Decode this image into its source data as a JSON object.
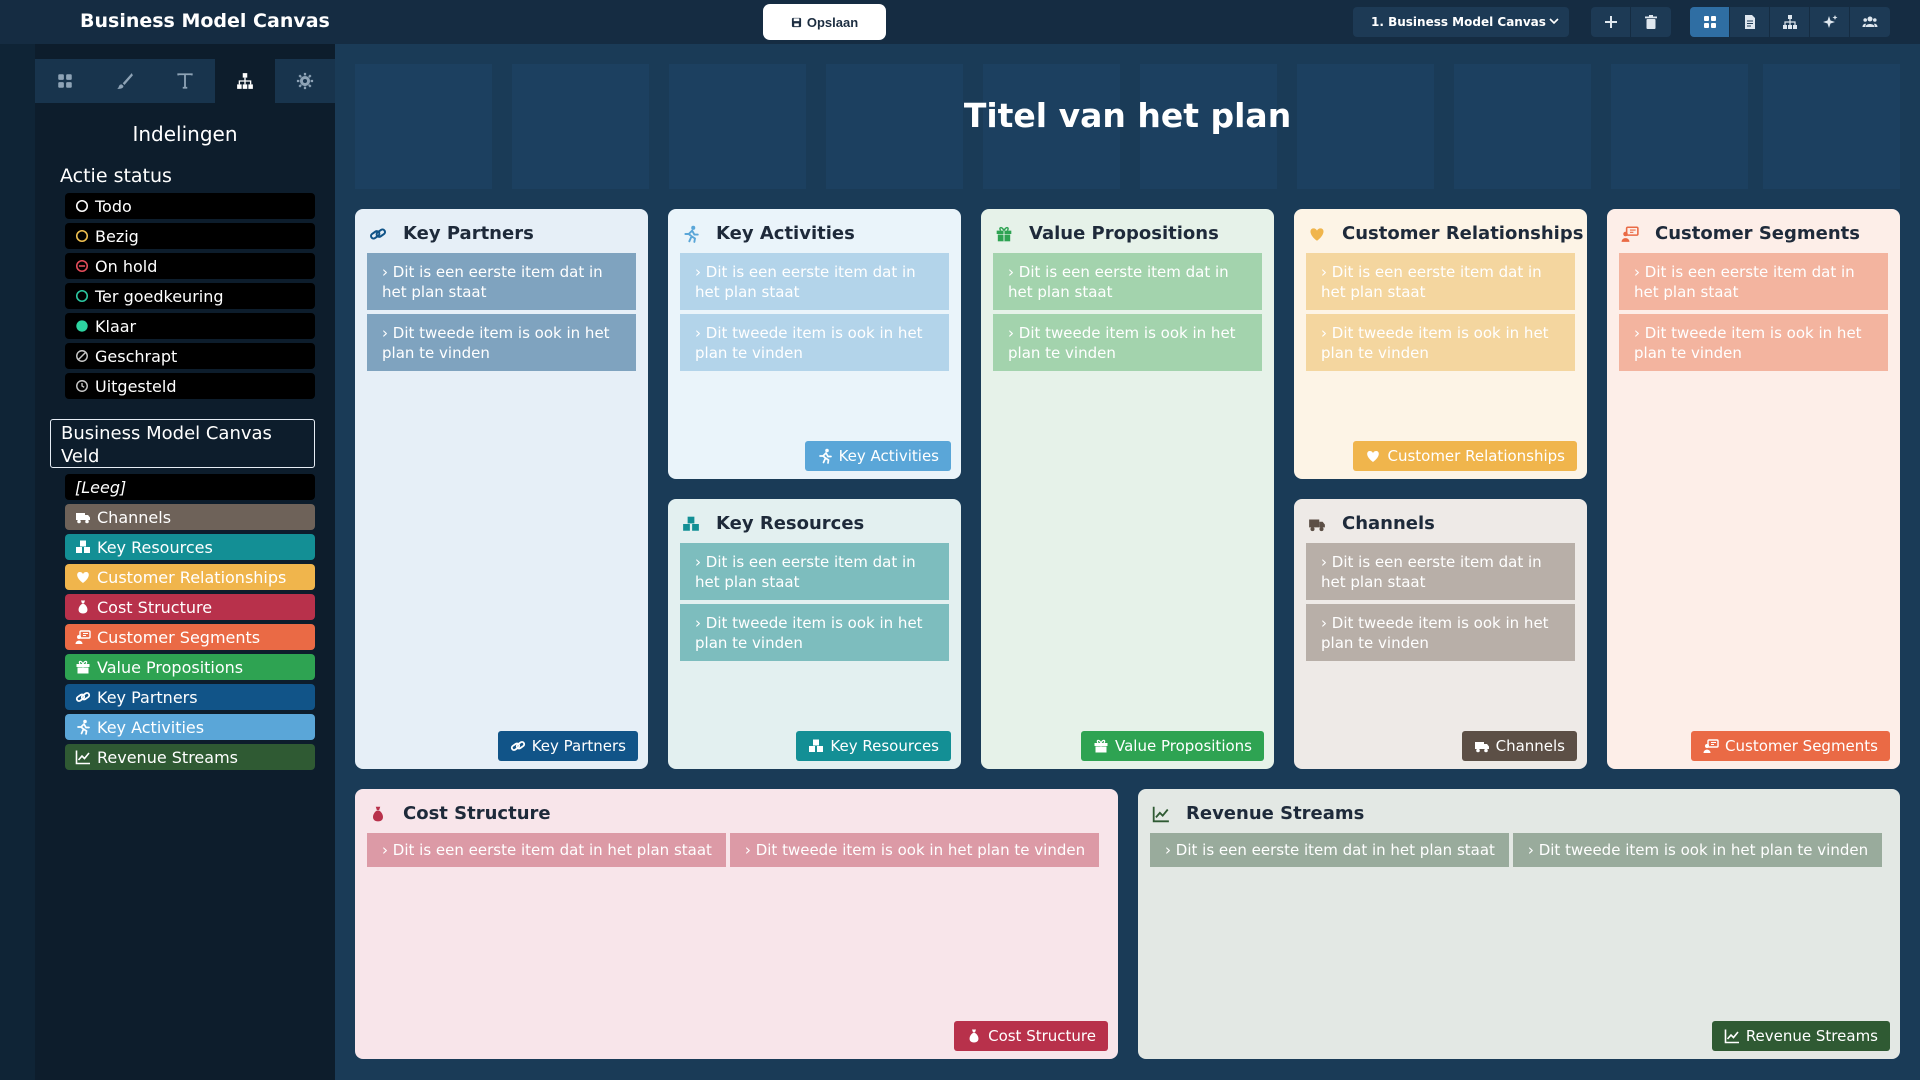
{
  "app": {
    "title": "Business Model Canvas",
    "save_label": "Opslaan",
    "plan_select": "1. Business Model Canvas"
  },
  "toolbar": {
    "actions": [
      {
        "icon": "plus-icon"
      },
      {
        "icon": "trash-icon"
      }
    ],
    "views": [
      {
        "icon": "grid-icon",
        "active": true
      },
      {
        "icon": "document-icon",
        "active": false
      },
      {
        "icon": "sitemap-icon",
        "active": false
      },
      {
        "icon": "sparkle-icon",
        "active": false
      },
      {
        "icon": "users-icon",
        "active": false
      }
    ]
  },
  "sidebar": {
    "tabs": [
      {
        "icon": "grid-icon",
        "active": false
      },
      {
        "icon": "brush-icon",
        "active": false
      },
      {
        "icon": "text-icon",
        "active": false
      },
      {
        "icon": "sitemap-icon",
        "active": true
      },
      {
        "icon": "gear-icon",
        "active": false
      }
    ],
    "heading": "Indelingen",
    "status_heading": "Actie status",
    "statuses": [
      {
        "label": "Todo",
        "color": "#ffffff",
        "icon": "circle-outline-icon"
      },
      {
        "label": "Bezig",
        "color": "#f0c050",
        "icon": "circle-outline-icon"
      },
      {
        "label": "On hold",
        "color": "#e54d5b",
        "icon": "circle-minus-icon"
      },
      {
        "label": "Ter goedkeuring",
        "color": "#2dc9a2",
        "icon": "circle-outline-icon"
      },
      {
        "label": "Klaar",
        "color": "#2dd4a0",
        "icon": "circle-filled-icon"
      },
      {
        "label": "Geschrapt",
        "color": "#c9c9c9",
        "icon": "circle-slash-icon"
      },
      {
        "label": "Uitgesteld",
        "color": "#c9c9c9",
        "icon": "circle-clock-icon"
      }
    ],
    "field_heading": "Business Model Canvas Veld",
    "fields": [
      {
        "label": "[Leeg]",
        "color": "#000000",
        "icon": ""
      },
      {
        "label": "Channels",
        "color": "#6e6259",
        "icon": "truck-icon"
      },
      {
        "label": "Key Resources",
        "color": "#138f95",
        "icon": "resources-icon"
      },
      {
        "label": "Customer Relationships",
        "color": "#f0b54c",
        "icon": "heart-icon"
      },
      {
        "label": "Cost Structure",
        "color": "#b8314b",
        "icon": "moneybag-icon"
      },
      {
        "label": "Customer Segments",
        "color": "#ea6a45",
        "icon": "segments-icon"
      },
      {
        "label": "Value Propositions",
        "color": "#2ea352",
        "icon": "gift-icon"
      },
      {
        "label": "Key Partners",
        "color": "#115488",
        "icon": "link-icon"
      },
      {
        "label": "Key Activities",
        "color": "#5aa6d8",
        "icon": "runner-icon"
      },
      {
        "label": "Revenue Streams",
        "color": "#2f5a33",
        "icon": "chart-icon"
      }
    ]
  },
  "canvas": {
    "title": "Titel van het plan",
    "blocks": {
      "key_partners": {
        "title": "Key Partners",
        "tag": "Key Partners",
        "icon": "link-icon",
        "colors": {
          "bg": "#e6eff7",
          "item": "#7fa3bf",
          "tag": "#115488",
          "icon": "#115488"
        },
        "items": [
          "Dit is een eerste item dat in het plan staat",
          "Dit tweede item is ook in het plan te vinden"
        ]
      },
      "key_activities": {
        "title": "Key Activities",
        "tag": "Key Activities",
        "icon": "runner-icon",
        "colors": {
          "bg": "#eaf4fa",
          "item": "#b3d4ea",
          "tag": "#5aa6d8",
          "icon": "#5aa6d8"
        },
        "items": [
          "Dit is een eerste item dat in het plan staat",
          "Dit tweede item is ook in het plan te vinden"
        ]
      },
      "key_resources": {
        "title": "Key Resources",
        "tag": "Key Resources",
        "icon": "resources-icon",
        "colors": {
          "bg": "#e3f0f0",
          "item": "#7dbdbe",
          "tag": "#138f95",
          "icon": "#138f95"
        },
        "items": [
          "Dit is een eerste item dat in het plan staat",
          "Dit tweede item is ook in het plan te vinden"
        ]
      },
      "value_propositions": {
        "title": "Value Propositions",
        "tag": "Value Propositions",
        "icon": "gift-icon",
        "colors": {
          "bg": "#e6f2e9",
          "item": "#a3d3ad",
          "tag": "#2ea352",
          "icon": "#2ea352"
        },
        "items": [
          "Dit is een eerste item dat in het plan staat",
          "Dit tweede item is ook in het plan te vinden"
        ]
      },
      "customer_relationships": {
        "title": "Customer Relationships",
        "tag": "Customer Relationships",
        "icon": "heart-icon",
        "colors": {
          "bg": "#fdf4e6",
          "item": "#f4d69f",
          "tag": "#f0b54c",
          "icon": "#f0b54c"
        },
        "items": [
          "Dit is een eerste item dat in het plan staat",
          "Dit tweede item is ook in het plan te vinden"
        ]
      },
      "channels": {
        "title": "Channels",
        "tag": "Channels",
        "icon": "truck-icon",
        "colors": {
          "bg": "#eeeae7",
          "item": "#b8afa8",
          "tag": "#5c4f46",
          "icon": "#5c4f46"
        },
        "items": [
          "Dit is een eerste item dat in het plan staat",
          "Dit tweede item is ook in het plan te vinden"
        ]
      },
      "customer_segments": {
        "title": "Customer Segments",
        "tag": "Customer Segments",
        "icon": "segments-icon",
        "colors": {
          "bg": "#fdeee8",
          "item": "#f3b49f",
          "tag": "#ea6a45",
          "icon": "#ea6a45"
        },
        "items": [
          "Dit is een eerste item dat in het plan staat",
          "Dit tweede item is ook in het plan te vinden"
        ]
      },
      "cost_structure": {
        "title": "Cost Structure",
        "tag": "Cost Structure",
        "icon": "moneybag-icon",
        "colors": {
          "bg": "#f8e5ea",
          "item": "#dc9aa6",
          "tag": "#b8314b",
          "icon": "#b8314b"
        },
        "items": [
          "Dit is een eerste item dat in het plan staat",
          "Dit tweede item is ook in het plan te vinden"
        ]
      },
      "revenue_streams": {
        "title": "Revenue Streams",
        "tag": "Revenue Streams",
        "icon": "chart-icon",
        "colors": {
          "bg": "#e3e8e4",
          "item": "#99ab9c",
          "tag": "#2f5a33",
          "icon": "#2f5a33"
        },
        "items": [
          "Dit is een eerste item dat in het plan staat",
          "Dit tweede item is ook in het plan te vinden"
        ]
      }
    }
  }
}
